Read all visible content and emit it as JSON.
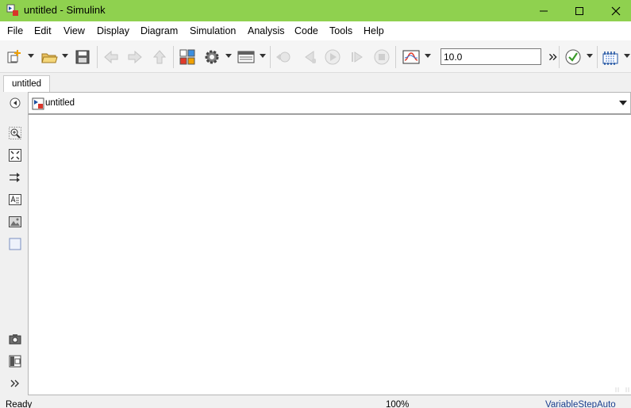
{
  "window": {
    "title": "untitled - Simulink",
    "accent_color": "#8fd14f"
  },
  "menu": {
    "items": [
      "File",
      "Edit",
      "View",
      "Display",
      "Diagram",
      "Simulation",
      "Analysis",
      "Code",
      "Tools",
      "Help"
    ]
  },
  "toolbar": {
    "stop_time": "10.0",
    "icons": [
      "new-model-icon",
      "open-folder-icon",
      "save-icon",
      "back-icon",
      "forward-icon",
      "up-icon",
      "library-browser-icon",
      "model-settings-icon",
      "model-explorer-icon",
      "step-back-icon",
      "step-back-single-icon",
      "run-icon",
      "step-forward-icon",
      "stop-icon",
      "scope-icon",
      "more-icon",
      "check-icon",
      "build-icon"
    ]
  },
  "tabs": [
    {
      "label": "untitled"
    }
  ],
  "address": {
    "crumb": "untitled"
  },
  "palette": {
    "icons": [
      "hide-show-icon",
      "zoom-icon",
      "fit-view-icon",
      "signal-routing-icon",
      "annotation-icon",
      "image-icon",
      "area-icon",
      "screenshot-icon",
      "model-browser-icon",
      "expand-icon"
    ]
  },
  "status": {
    "state": "Ready",
    "zoom": "100%",
    "solver": "VariableStepAuto"
  }
}
